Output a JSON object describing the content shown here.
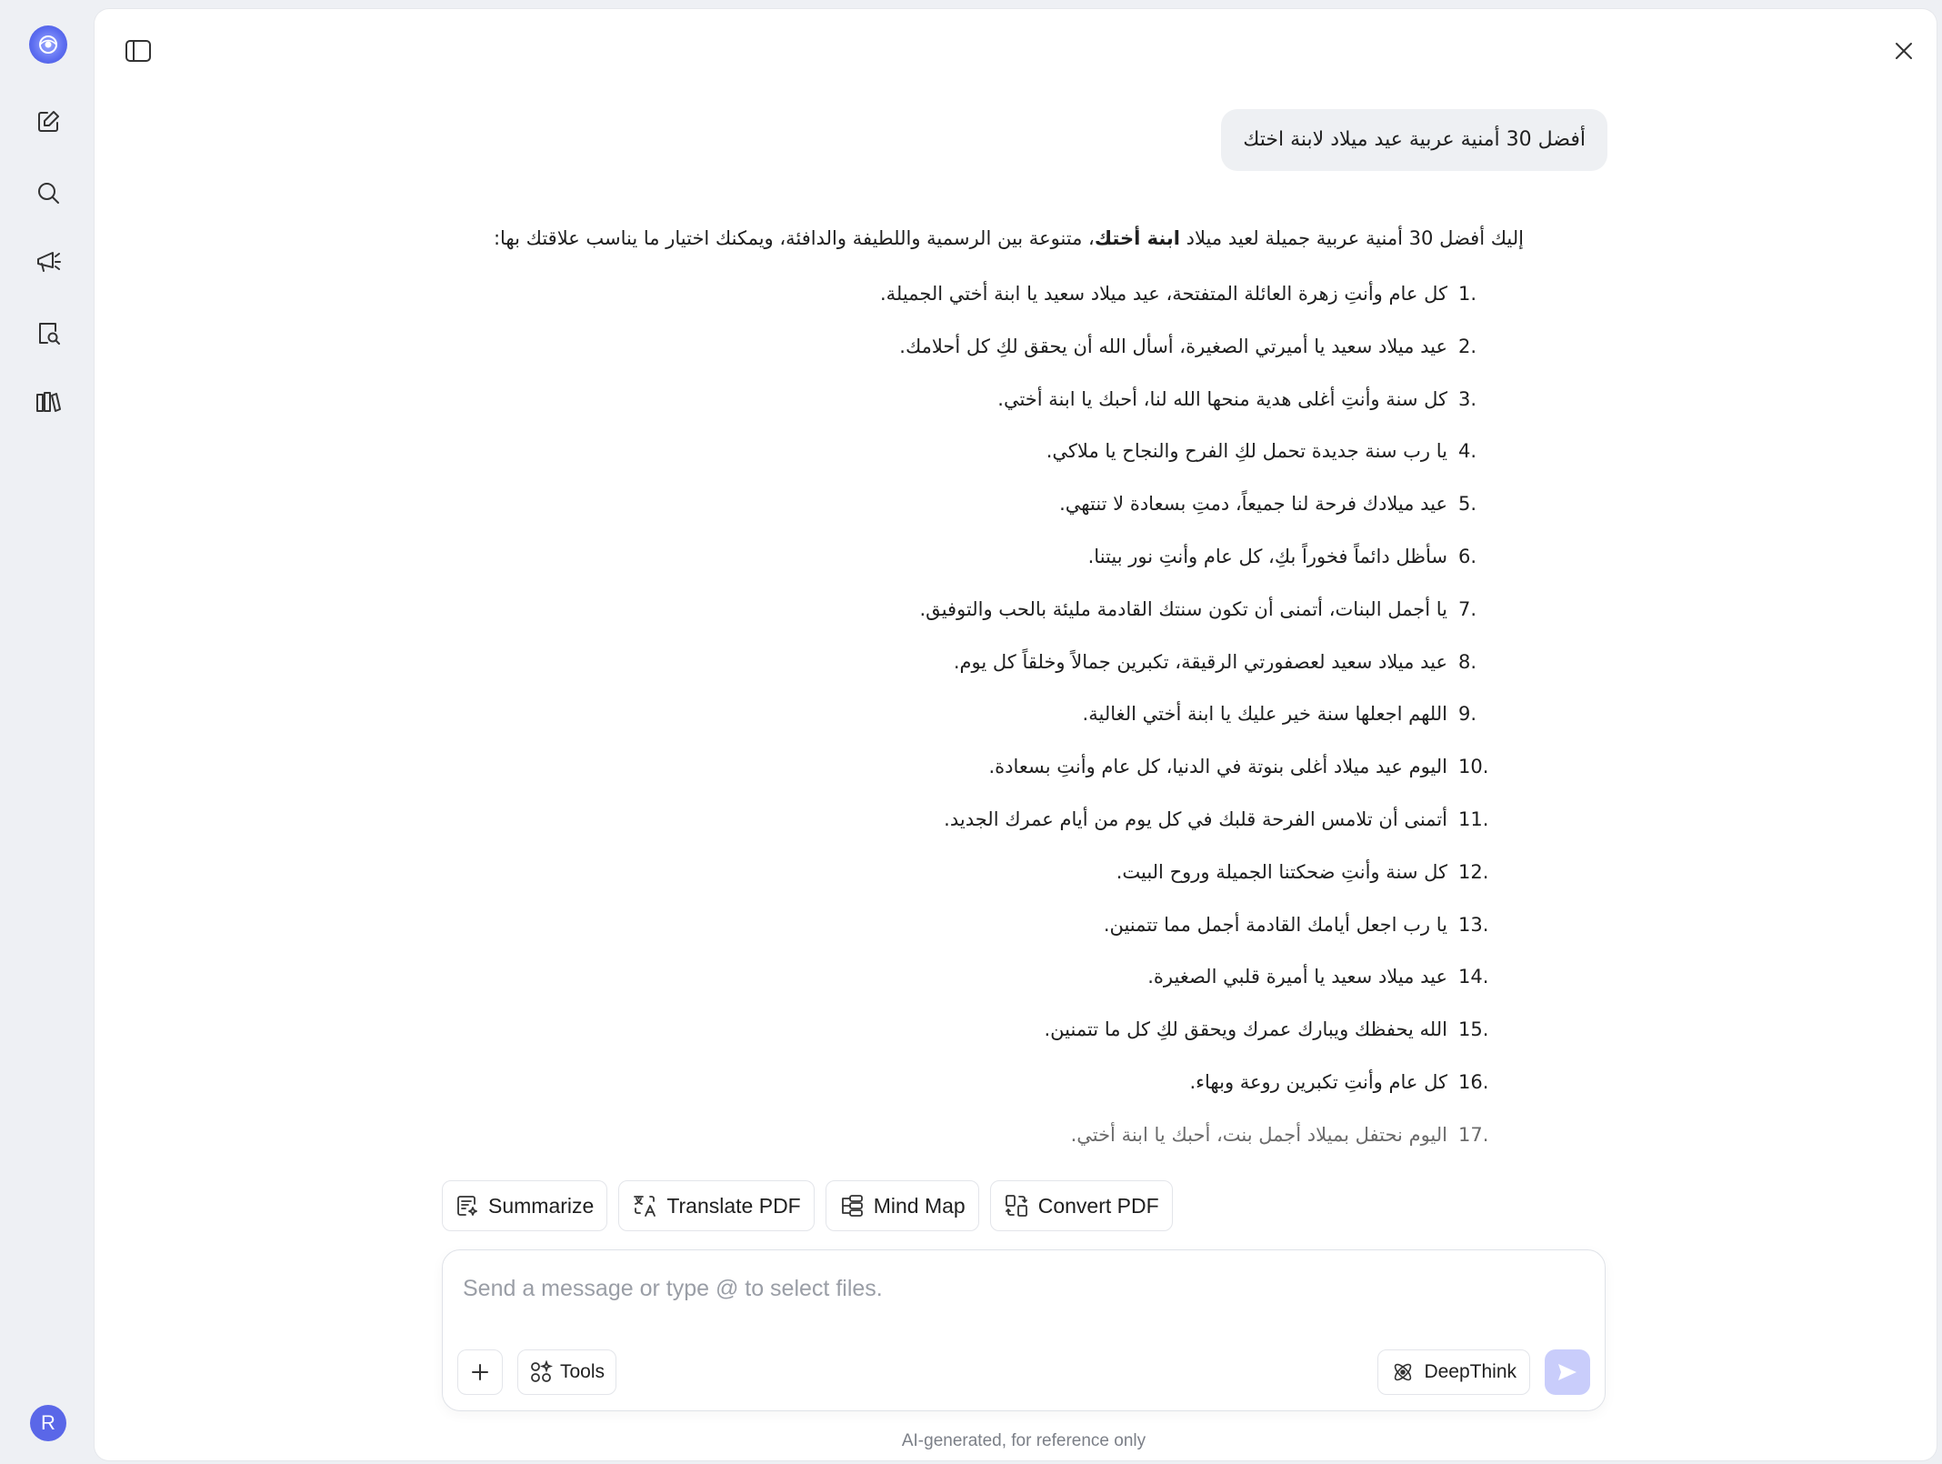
{
  "sidebar": {
    "icons": [
      "app-logo-icon",
      "new-chat-icon",
      "search-icon",
      "megaphone-icon",
      "doc-search-icon",
      "library-icon"
    ],
    "avatar_letter": "R"
  },
  "conversation": {
    "user_message": "أفضل 30 أمنية عربية عيد ميلاد لابنة اختك",
    "intro_before": "إليك أفضل 30 أمنية عربية جميلة لعيد ميلاد ",
    "intro_bold": "ابنة أختك",
    "intro_after": "، متنوعة بين الرسمية واللطيفة والدافئة، ويمكنك اختيار ما يناسب علاقتك بها:",
    "wishes": [
      {
        "num": "1.",
        "text": "كل عام وأنتِ زهرة العائلة المتفتحة، عيد ميلاد سعيد يا ابنة أختي الجميلة."
      },
      {
        "num": "2.",
        "text": "عيد ميلاد سعيد يا أميرتي الصغيرة، أسأل الله أن يحقق لكِ كل أحلامك."
      },
      {
        "num": "3.",
        "text": "كل سنة وأنتِ أغلى هدية منحها الله لنا، أحبك يا ابنة أختي."
      },
      {
        "num": "4.",
        "text": "يا رب سنة جديدة تحمل لكِ الفرح والنجاح يا ملاكي."
      },
      {
        "num": "5.",
        "text": "عيد ميلادك فرحة لنا جميعاً، دمتِ بسعادة لا تنتهي."
      },
      {
        "num": "6.",
        "text": "سأظل دائماً فخوراً بكِ، كل عام وأنتِ نور بيتنا."
      },
      {
        "num": "7.",
        "text": "يا أجمل البنات، أتمنى أن تكون سنتك القادمة مليئة بالحب والتوفيق."
      },
      {
        "num": "8.",
        "text": "عيد ميلاد سعيد لعصفورتي الرقيقة، تكبرين جمالاً وخلقاً كل يوم."
      },
      {
        "num": "9.",
        "text": "اللهم اجعلها سنة خير عليك يا ابنة أختي الغالية."
      },
      {
        "num": "10.",
        "text": "اليوم عيد ميلاد أغلى بنوتة في الدنيا، كل عام وأنتِ بسعادة."
      },
      {
        "num": "11.",
        "text": "أتمنى أن تلامس الفرحة قلبك في كل يوم من أيام عمرك الجديد."
      },
      {
        "num": "12.",
        "text": "كل سنة وأنتِ ضحكتنا الجميلة وروح البيت."
      },
      {
        "num": "13.",
        "text": "يا رب اجعل أيامك القادمة أجمل مما تتمنين."
      },
      {
        "num": "14.",
        "text": "عيد ميلاد سعيد يا أميرة قلبي الصغيرة."
      },
      {
        "num": "15.",
        "text": "الله يحفظك ويبارك عمرك ويحقق لكِ كل ما تتمنين."
      },
      {
        "num": "16.",
        "text": "كل عام وأنتِ تكبرين روعة وبهاء."
      },
      {
        "num": "17.",
        "text": "اليوم نحتفل بميلاد أجمل بنت، أحبك يا ابنة أختي."
      }
    ]
  },
  "actions": {
    "summarize": "Summarize",
    "translate_pdf": "Translate PDF",
    "mind_map": "Mind Map",
    "convert_pdf": "Convert PDF"
  },
  "composer": {
    "placeholder": "Send a message or type @ to select files.",
    "value": "",
    "tools_label": "Tools",
    "deepthink_label": "DeepThink"
  },
  "footer": {
    "disclaimer": "AI-generated, for reference only"
  },
  "colors": {
    "accent": "#5b6cf0",
    "send_disabled": "#c9cdfb",
    "bubble_bg": "#eef0f3",
    "app_bg": "#eef0f4"
  }
}
